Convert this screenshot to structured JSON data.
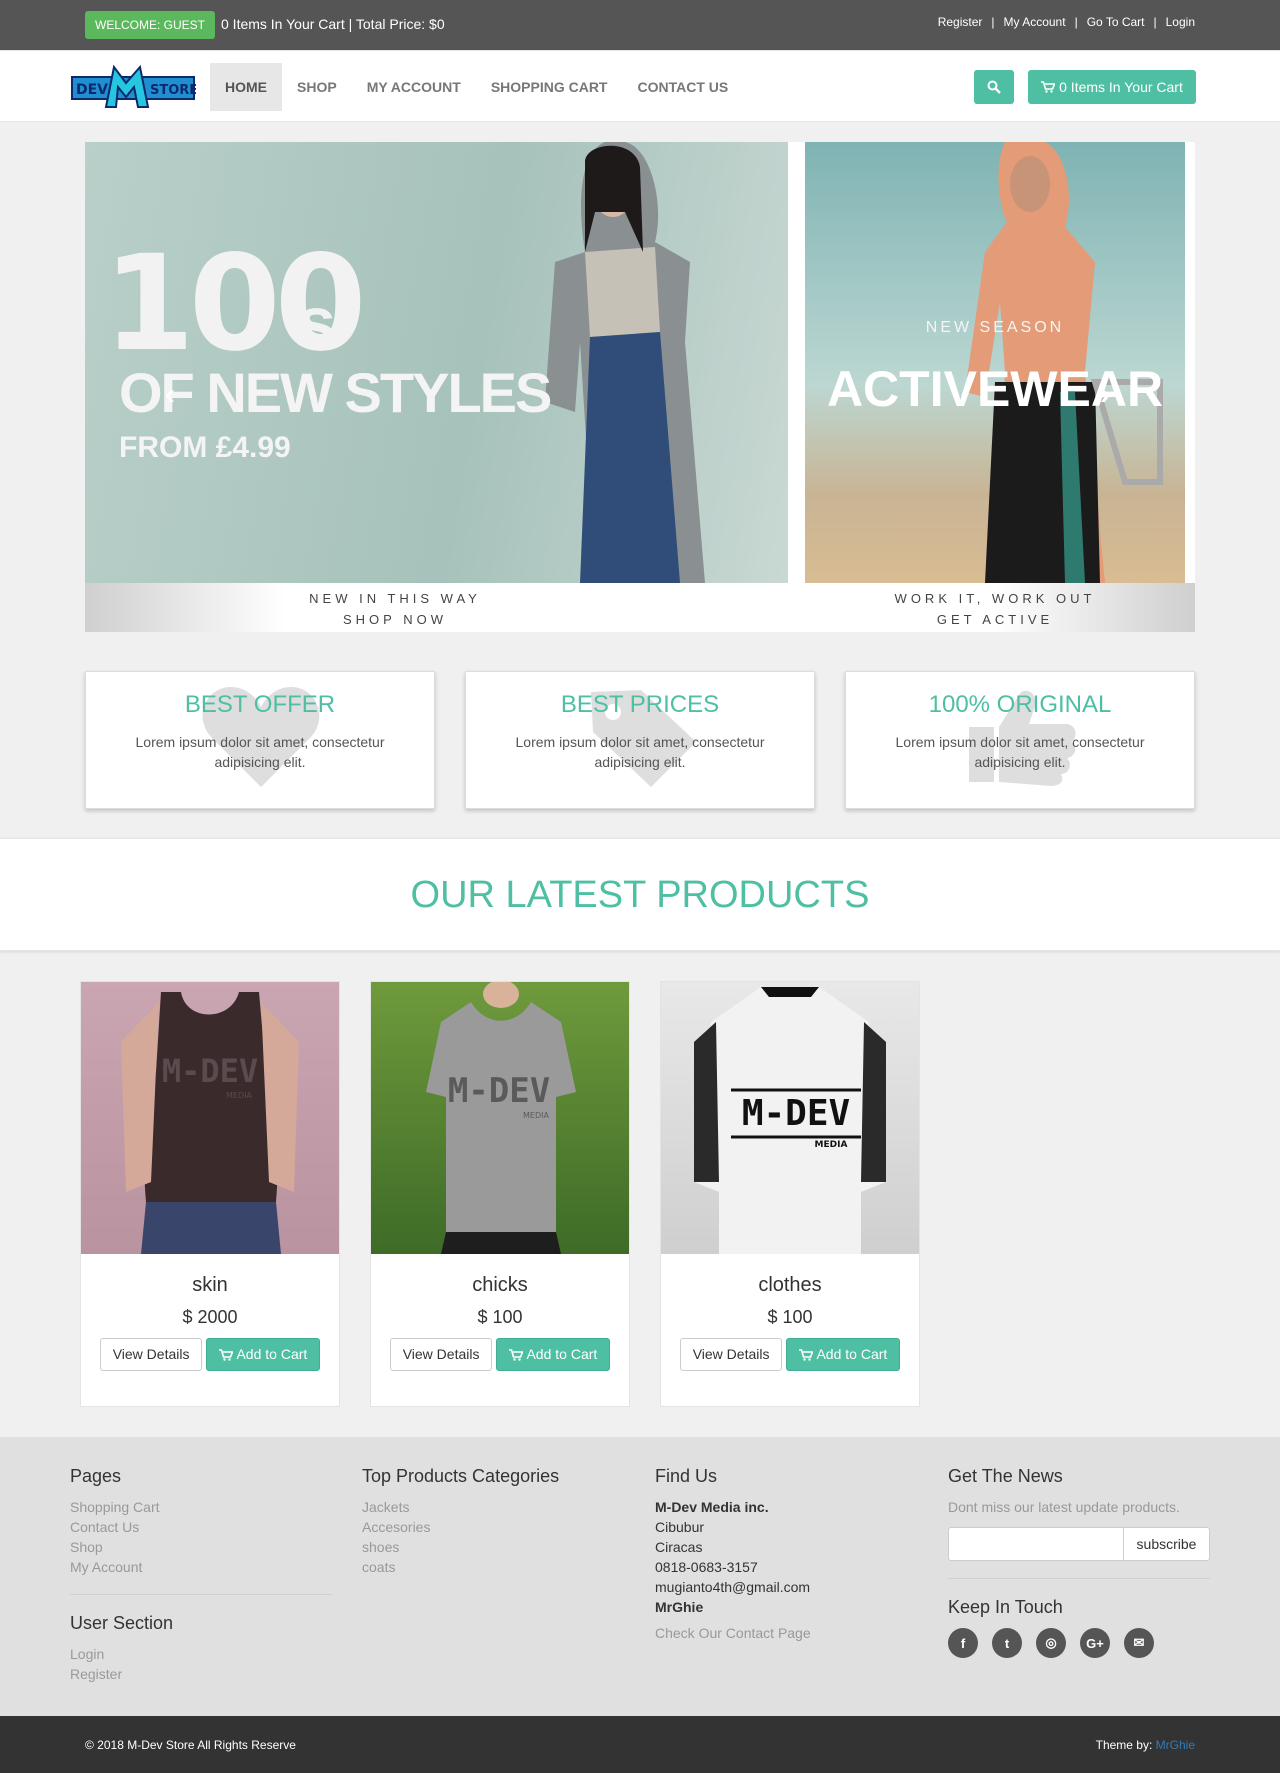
{
  "topbar": {
    "welcome": "Welcome: Guest",
    "cart_summary": "0 Items In Your Cart | Total Price: $0",
    "links": [
      "Register",
      "My Account",
      "Go To Cart",
      "Login"
    ]
  },
  "brand": {
    "logo_left": "DEV",
    "logo_mid": "M",
    "logo_right": "STORE"
  },
  "nav": {
    "items": [
      "Home",
      "Shop",
      "My Account",
      "Shopping Cart",
      "Contact Us"
    ],
    "active": "Home",
    "cart_button": "0 Items In Your Cart",
    "search_icon": "search-icon",
    "cart_icon": "shopping-cart-icon"
  },
  "hero": {
    "slide1": {
      "big": "100",
      "big_suffix": "s",
      "line2": "OF NEW STYLES",
      "line3": "FROM £4.99",
      "strip_line1": "NEW IN THIS WAY",
      "strip_line2": "SHOP NOW"
    },
    "slide2": {
      "kicker": "NEW SEASON",
      "title": "ACTIVEWEAR",
      "strip_line1": "WORK IT, WORK OUT",
      "strip_line2": "GET ACTIVE"
    },
    "prev_glyph": "‹",
    "next_glyph": "›"
  },
  "features": [
    {
      "title": "BEST OFFER",
      "text": "Lorem ipsum dolor sit amet, consectetur adipisicing elit.",
      "icon": "heart-icon"
    },
    {
      "title": "BEST PRICES",
      "text": "Lorem ipsum dolor sit amet, consectetur adipisicing elit.",
      "icon": "tag-icon"
    },
    {
      "title": "100% ORIGINAL",
      "text": "Lorem ipsum dolor sit amet, consectetur adipisicing elit.",
      "icon": "thumbs-up-icon"
    }
  ],
  "latest": {
    "title": "OUR LATEST PRODUCTS"
  },
  "products": [
    {
      "name": "skin",
      "price": "$ 2000",
      "details": "View Details",
      "add": "Add to Cart",
      "shirt_text": "M-DEV",
      "shirt_sub": "MEDIA"
    },
    {
      "name": "chicks",
      "price": "$ 100",
      "details": "View Details",
      "add": "Add to Cart",
      "shirt_text": "M-DEV",
      "shirt_sub": "MEDIA"
    },
    {
      "name": "clothes",
      "price": "$ 100",
      "details": "View Details",
      "add": "Add to Cart",
      "shirt_text": "M-DEV",
      "shirt_sub": "MEDIA"
    }
  ],
  "footer": {
    "pages": {
      "title": "Pages",
      "links": [
        "Shopping Cart",
        "Contact Us",
        "Shop",
        "My Account"
      ]
    },
    "user": {
      "title": "User Section",
      "links": [
        "Login",
        "Register"
      ]
    },
    "categories": {
      "title": "Top Products Categories",
      "links": [
        "Jackets",
        "Accesories",
        "shoes",
        "coats"
      ]
    },
    "find": {
      "title": "Find Us",
      "company": "M-Dev Media inc.",
      "lines": [
        "Cibubur",
        "Ciracas",
        "0818-0683-3157",
        "mugianto4th@gmail.com"
      ],
      "person": "MrGhie",
      "contact_link": "Check Our Contact Page"
    },
    "news": {
      "title": "Get The News",
      "text": "Dont miss our latest update products.",
      "subscribe": "subscribe",
      "keep_title": "Keep In Touch",
      "social": [
        {
          "icon": "facebook-icon",
          "glyph": "f"
        },
        {
          "icon": "twitter-icon",
          "glyph": "t"
        },
        {
          "icon": "instagram-icon",
          "glyph": "◎"
        },
        {
          "icon": "google-plus-icon",
          "glyph": "G+"
        },
        {
          "icon": "envelope-icon",
          "glyph": "✉"
        }
      ]
    }
  },
  "bottom": {
    "copyright": "© 2018 M-Dev Store All Rights Reserve",
    "theme_label": "Theme by: ",
    "theme_author": "MrGhie"
  },
  "colors": {
    "accent": "#4ebfa3",
    "topbar": "#555555",
    "welcome": "#5cb85c",
    "footer": "#e0e0e0",
    "bottombar": "#333333"
  }
}
